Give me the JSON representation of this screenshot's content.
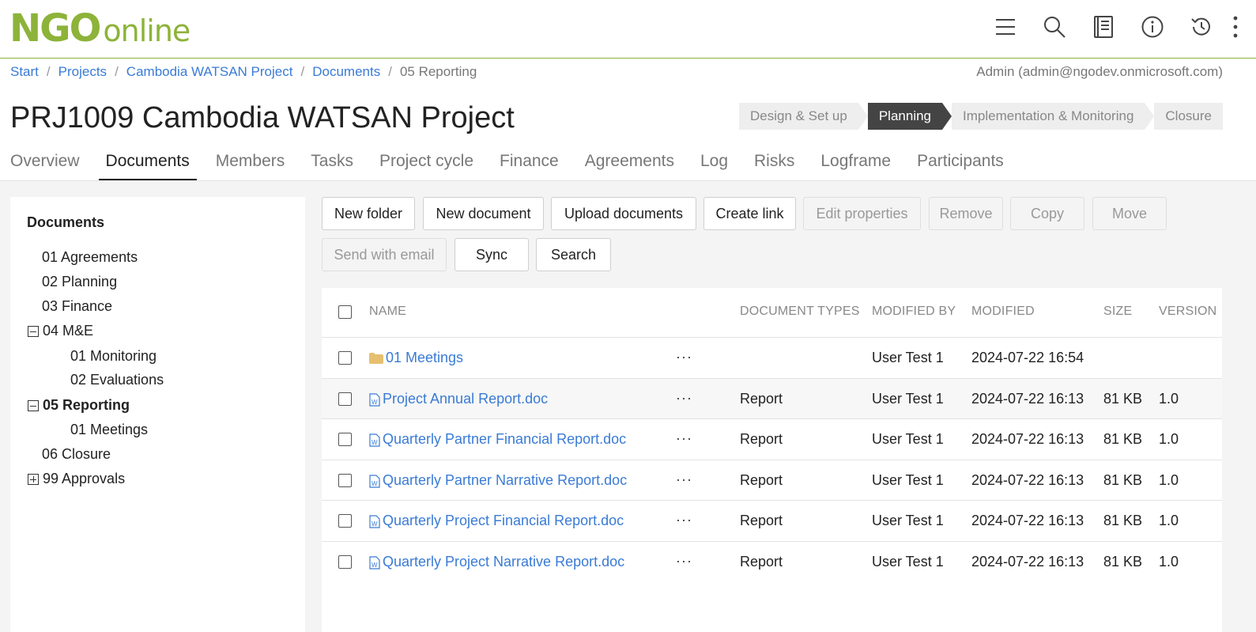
{
  "brand": {
    "logo_main": "NGO",
    "logo_sub": "online",
    "color": "#8db33a"
  },
  "header_icons": [
    "menu-icon",
    "search-icon",
    "book-icon",
    "info-icon",
    "history-icon",
    "more-vertical-icon"
  ],
  "breadcrumb": {
    "items": [
      "Start",
      "Projects",
      "Cambodia WATSAN Project",
      "Documents"
    ],
    "current": "05 Reporting"
  },
  "user": "Admin (admin@ngodev.onmicrosoft.com)",
  "page_title": "PRJ1009 Cambodia WATSAN Project",
  "phases": [
    "Design & Set up",
    "Planning",
    "Implementation & Monitoring",
    "Closure"
  ],
  "active_phase": "Planning",
  "tabs": [
    "Overview",
    "Documents",
    "Members",
    "Tasks",
    "Project cycle",
    "Finance",
    "Agreements",
    "Log",
    "Risks",
    "Logframe",
    "Participants"
  ],
  "active_tab": "Documents",
  "sidebar": {
    "title": "Documents",
    "items": [
      {
        "label": "01 Agreements"
      },
      {
        "label": "02 Planning"
      },
      {
        "label": "03 Finance"
      },
      {
        "label": "04 M&E",
        "toggle": "minus"
      },
      {
        "label": "01 Monitoring"
      },
      {
        "label": "02 Evaluations"
      },
      {
        "label": "05 Reporting",
        "toggle": "minus",
        "selected": true
      },
      {
        "label": "01 Meetings"
      },
      {
        "label": "06 Closure"
      },
      {
        "label": "99 Approvals",
        "toggle": "plus"
      }
    ]
  },
  "toolbar": {
    "new_folder": "New folder",
    "new_document": "New document",
    "upload_documents": "Upload documents",
    "create_link": "Create link",
    "edit_properties": "Edit properties",
    "remove": "Remove",
    "copy": "Copy",
    "move": "Move",
    "send_with_email": "Send with email",
    "sync": "Sync",
    "search": "Search"
  },
  "table": {
    "headers": {
      "name": "NAME",
      "document_types": "DOCUMENT TYPES",
      "modified_by": "MODIFIED BY",
      "modified": "MODIFIED",
      "size": "SIZE",
      "version": "VERSION"
    },
    "rows": [
      {
        "name": "01 Meetings",
        "icon": "folder-icon",
        "more": "···",
        "doc_type": "",
        "modified_by": "User Test 1",
        "modified": "2024-07-22 16:54",
        "size": "",
        "version": ""
      },
      {
        "name": "Project Annual Report.doc",
        "icon": "word-doc-icon",
        "more": "···",
        "doc_type": "Report",
        "modified_by": "User Test 1",
        "modified": "2024-07-22 16:13",
        "size": "81 KB",
        "version": "1.0"
      },
      {
        "name": "Quarterly Partner Financial Report.doc",
        "icon": "word-doc-icon",
        "more": "···",
        "doc_type": "Report",
        "modified_by": "User Test 1",
        "modified": "2024-07-22 16:13",
        "size": "81 KB",
        "version": "1.0"
      },
      {
        "name": "Quarterly Partner Narrative Report.doc",
        "icon": "word-doc-icon",
        "more": "···",
        "doc_type": "Report",
        "modified_by": "User Test 1",
        "modified": "2024-07-22 16:13",
        "size": "81 KB",
        "version": "1.0"
      },
      {
        "name": "Quarterly Project Financial Report.doc",
        "icon": "word-doc-icon",
        "more": "···",
        "doc_type": "Report",
        "modified_by": "User Test 1",
        "modified": "2024-07-22 16:13",
        "size": "81 KB",
        "version": "1.0"
      },
      {
        "name": "Quarterly Project Narrative Report.doc",
        "icon": "word-doc-icon",
        "more": "···",
        "doc_type": "Report",
        "modified_by": "User Test 1",
        "modified": "2024-07-22 16:13",
        "size": "81 KB",
        "version": "1.0"
      }
    ]
  }
}
